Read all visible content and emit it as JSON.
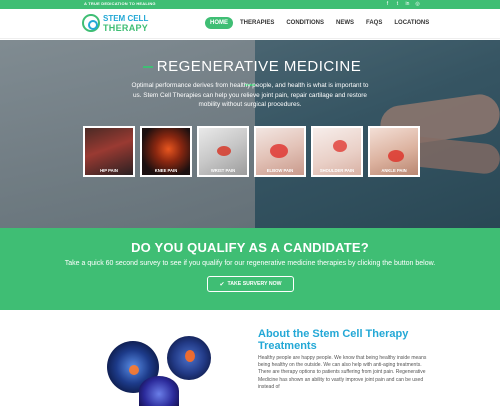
{
  "topbar": {
    "tagline": "A TRUE DEDICATION TO HEALING",
    "social_icons": [
      "facebook-icon",
      "twitter-icon",
      "linkedin-icon",
      "instagram-icon"
    ],
    "social_glyphs": [
      "f",
      "t",
      "in",
      "◎"
    ]
  },
  "logo": {
    "line1": "STEM CELL",
    "line2": "THERAPY"
  },
  "nav": {
    "items": [
      "HOME",
      "THERAPIES",
      "CONDITIONS",
      "NEWS",
      "FAQS",
      "LOCATIONS"
    ],
    "active": "HOME"
  },
  "hero": {
    "title": "REGENERATIVE MEDICINE",
    "description": "Optimal performance derives from healthy people, and health is what is important to us. Stem Cell Therapies can help you relieve joint pain, repair cartilage and restore mobility without surgical procedures.",
    "conditions": [
      "HIP PAIN",
      "KNEE PAIN",
      "WRIST PAIN",
      "ELBOW PAIN",
      "SHOULDER PAIN",
      "ANKLE PAIN"
    ]
  },
  "cta": {
    "heading": "DO YOU QUALIFY AS A CANDIDATE?",
    "text": "Take a quick 60 second survey to see if you qualify for our regenerative medicine therapies by clicking the button below.",
    "button_label": "TAKE SURVERY NOW"
  },
  "about": {
    "heading": "About the Stem Cell Therapy Treatments",
    "text": "Healthy people are happy people. We know that being healthy inside means being healthy on the outside. We can also help with anti-aging treatments. There are therapy options to patients suffering from joint pain. Regenerative Medicine has shown an ability to vastly improve joint pain and can be used instead of"
  },
  "colors": {
    "brand_green": "#3fbe74",
    "brand_blue": "#23a8d6"
  }
}
